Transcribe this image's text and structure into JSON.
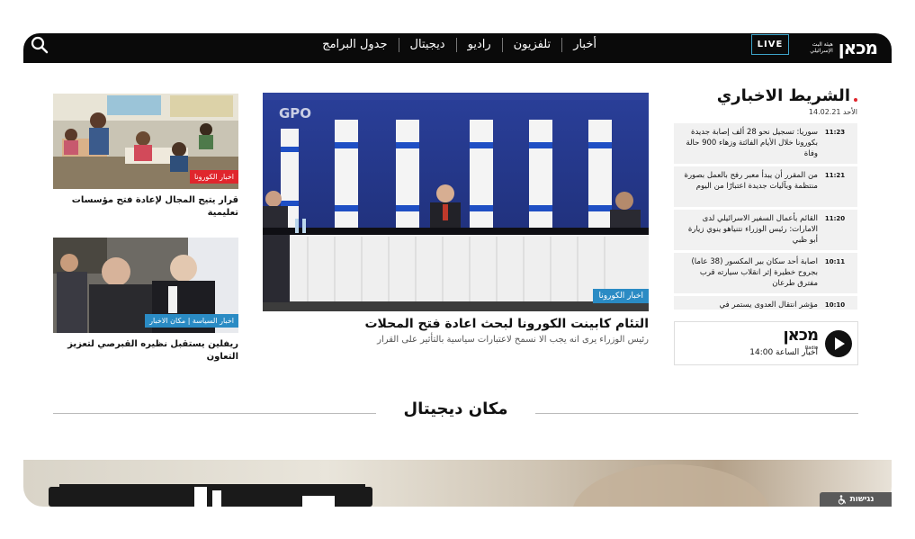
{
  "header": {
    "logo_text": "מכאן",
    "logo_sub": "هيئة البث الإسرائيلي",
    "live_label": "LIVE",
    "nav": [
      "أخبار",
      "تلفزيون",
      "راديو",
      "ديجيتال",
      "جدول البرامج"
    ],
    "search_icon": "search-icon"
  },
  "feature": {
    "tag": "اخبار الكورونا",
    "headline": "التئام كابينت الكورونا لبحث اعادة فتح المحلات",
    "subline": "رئيس الوزراء يرى انه يجب الا نسمح لاعتبارات سياسية بالتأثير على القرار",
    "gpo_label": "GPO"
  },
  "cards": [
    {
      "tag": "اخبار الكورونا",
      "tag_color": "#e0262d",
      "title": "قرار يتيح المجال لإعادة فتح مؤسسات تعليمية"
    },
    {
      "tag": "اخبار السياسة | مكان الاخبار",
      "tag_color": "#2a8bc4",
      "title": "ريفلين يستقبل نظيره القبرصي لتعزيز التعاون"
    }
  ],
  "ticker": {
    "title": "الشريط الاخباري",
    "date": "الأحد 14.02.21",
    "items": [
      {
        "time": "11:23",
        "text": "سوريا: تسجيل نحو 28 ألف إصابة جديدة بكورونا خلال الأيام الفائتة وزهاء 900 حالة وفاة"
      },
      {
        "time": "11:21",
        "text": "من المقرر أن يبدأ معبر رفح بالعمل بصورة منتظمة وبآليات جديدة اعتبارًا من اليوم"
      },
      {
        "time": "11:20",
        "text": "القائم بأعمال السفير الاسرائيلي لدى الامارات: رئيس الوزراء نتنياهو ينوي زيارة أبو ظبي"
      },
      {
        "time": "10:11",
        "text": "اصابة أحد سكان بير المكسور (38 عاما) بجروح خطيرة إثر انقلاب سيارته قرب مفترق طرعان"
      },
      {
        "time": "10:10",
        "text": "مؤشر انتقال العدوى يستمر في"
      }
    ]
  },
  "radio": {
    "logo_text": "מכאן",
    "logo_sub": "Radio",
    "schedule": "أخبار الساعة 14:00"
  },
  "section": {
    "title": "مكان ديجيتال"
  },
  "accessibility": {
    "label": "נגישות"
  }
}
